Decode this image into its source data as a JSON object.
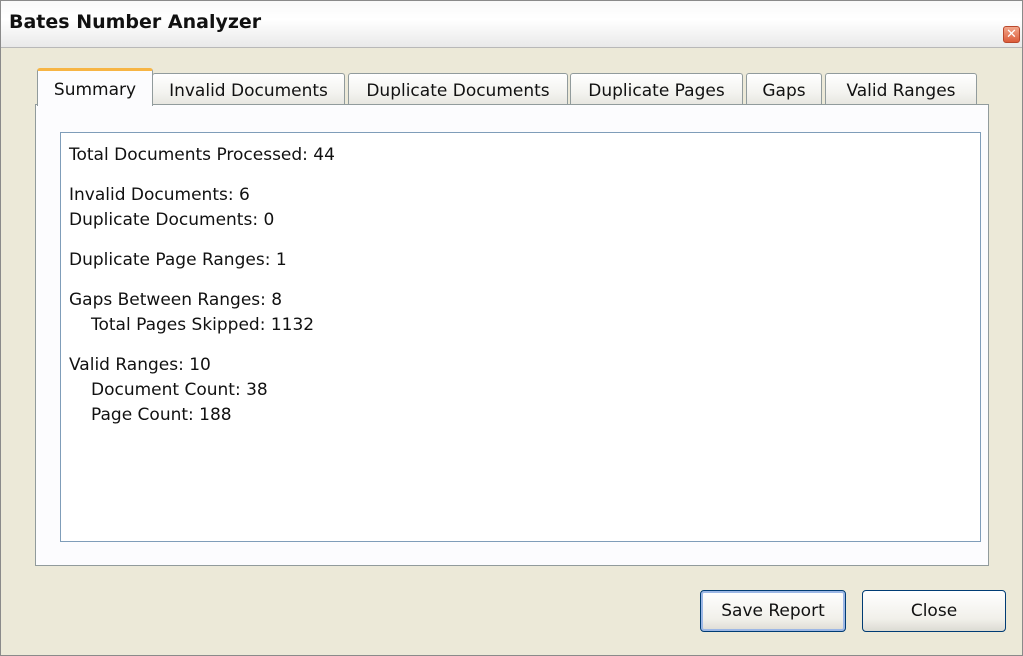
{
  "window": {
    "title": "Bates Number Analyzer",
    "close_glyph": "✕"
  },
  "tabs": [
    {
      "label": "Summary",
      "active": true
    },
    {
      "label": "Invalid Documents",
      "active": false
    },
    {
      "label": "Duplicate Documents",
      "active": false
    },
    {
      "label": "Duplicate Pages",
      "active": false
    },
    {
      "label": "Gaps",
      "active": false
    },
    {
      "label": "Valid Ranges",
      "active": false
    }
  ],
  "summary": {
    "total_documents": "Total Documents Processed: 44",
    "invalid_documents": "Invalid Documents: 6",
    "duplicate_documents": "Duplicate Documents: 0",
    "duplicate_page_ranges": "Duplicate Page Ranges: 1",
    "gaps_between_ranges": "Gaps Between Ranges: 8",
    "total_pages_skipped": "Total Pages Skipped: 1132",
    "valid_ranges": "Valid Ranges: 10",
    "document_count": "Document Count: 38",
    "page_count": "Page Count: 188"
  },
  "buttons": {
    "save_report": "Save Report",
    "close": "Close"
  },
  "colors": {
    "window_bg": "#ece9d8",
    "active_tab_accent": "#f7b544",
    "close_button": "#dc5c3a",
    "button_border": "#003c74"
  }
}
